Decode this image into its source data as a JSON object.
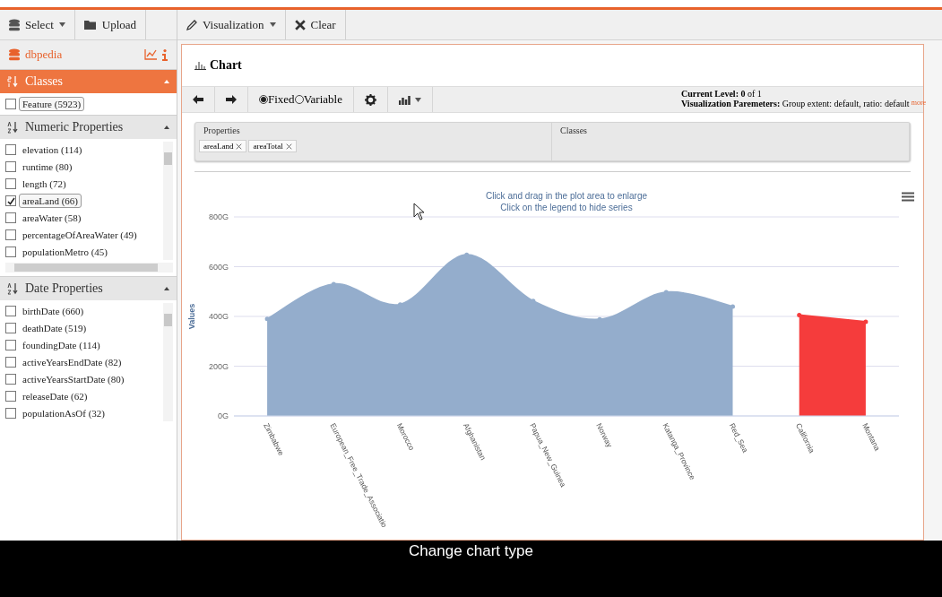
{
  "sidebar_toolbar": {
    "select": "Select",
    "upload": "Upload"
  },
  "dataset": {
    "name": "dbpedia"
  },
  "sections": [
    {
      "title": "Classes",
      "kind": "numeric",
      "active": true,
      "items": [
        {
          "label": "Feature (5923)",
          "checked": false,
          "selected": true
        }
      ]
    },
    {
      "title": "Numeric Properties",
      "kind": "alpha",
      "active": false,
      "items": [
        {
          "label": "elevation (114)",
          "checked": false,
          "selected": false
        },
        {
          "label": "runtime (80)",
          "checked": false,
          "selected": false
        },
        {
          "label": "length (72)",
          "checked": false,
          "selected": false
        },
        {
          "label": "areaLand (66)",
          "checked": true,
          "selected": true
        },
        {
          "label": "areaWater (58)",
          "checked": false,
          "selected": false
        },
        {
          "label": "percentageOfAreaWater (49)",
          "checked": false,
          "selected": false
        },
        {
          "label": "populationMetro (45)",
          "checked": false,
          "selected": false
        }
      ]
    },
    {
      "title": "Date Properties",
      "kind": "alpha",
      "active": false,
      "items": [
        {
          "label": "birthDate (660)",
          "checked": false,
          "selected": false
        },
        {
          "label": "deathDate (519)",
          "checked": false,
          "selected": false
        },
        {
          "label": "foundingDate (114)",
          "checked": false,
          "selected": false
        },
        {
          "label": "activeYearsEndDate (82)",
          "checked": false,
          "selected": false
        },
        {
          "label": "activeYearsStartDate (80)",
          "checked": false,
          "selected": false
        },
        {
          "label": "releaseDate (62)",
          "checked": false,
          "selected": false
        },
        {
          "label": "populationAsOf (32)",
          "checked": false,
          "selected": false
        }
      ]
    }
  ],
  "main_toolbar": {
    "visualization": "Visualization",
    "clear": "Clear"
  },
  "panel": {
    "title": "Chart",
    "modes": [
      {
        "label": "Fixed",
        "selected": true
      },
      {
        "label": "Variable",
        "selected": false
      }
    ],
    "current_level": "**Current Level:** **0** of 1",
    "parameters": "**Visualization Paremeters:** Group extent: default, ratio: default",
    "more_link": "more",
    "drop_zones": [
      {
        "title": "Properties",
        "chips": [
          "areaLand",
          "areaTotal"
        ]
      },
      {
        "title": "Classes"
      }
    ],
    "chart": {
      "subtitle": [
        "Click and drag in the plot area to enlarge",
        "Click on the legend to hide series"
      ],
      "chart_data": {
        "type": "area",
        "ylabel": "Values",
        "categories": [
          "Zimbabwe",
          "European_Free_Trade_Associatio",
          "Morocco",
          "Afghanistan",
          "Papua_New_Guinea",
          "Norway",
          "Katanga_Province",
          "Red_Sea",
          "California",
          "Montana"
        ],
        "series": [
          {
            "color": "#94adcc",
            "values": [
              390,
              530,
              448,
              648,
              462,
              388,
              497,
              440,
              null,
              null
            ]
          },
          {
            "color": "#f53c3c",
            "values": [
              null,
              null,
              null,
              null,
              null,
              null,
              null,
              null,
              405,
              378
            ]
          }
        ],
        "ylim": [
          0,
          800
        ],
        "grid": true,
        "yticks": [
          {
            "value": 0,
            "label": "0G"
          },
          {
            "value": 200,
            "label": "200G"
          },
          {
            "value": 400,
            "label": "400G"
          },
          {
            "value": 600,
            "label": "600G"
          },
          {
            "value": 800,
            "label": "800G"
          }
        ]
      }
    }
  },
  "caption": "Change chart type"
}
